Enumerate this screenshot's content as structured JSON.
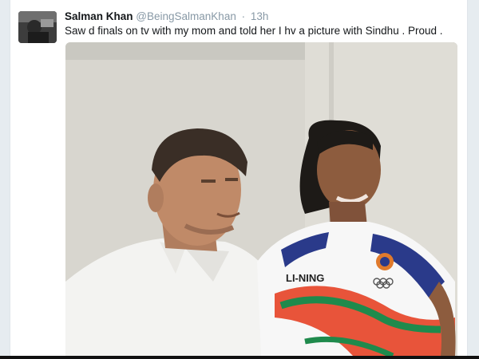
{
  "tweet": {
    "author_name": "Salman Khan",
    "author_handle": "@BeingSalmanKhan",
    "separator": "·",
    "timestamp": "13h",
    "text": "Saw d finals on tv with my mom and told her I hv a picture with Sindhu . Proud .",
    "avatar_icon": "profile-photo",
    "media": {
      "type": "photo",
      "jersey_brand_text": "LI-NING"
    }
  },
  "colors": {
    "background": "#e6ecf0",
    "card": "#ffffff",
    "name": "#14171a",
    "muted": "#8899a6"
  }
}
